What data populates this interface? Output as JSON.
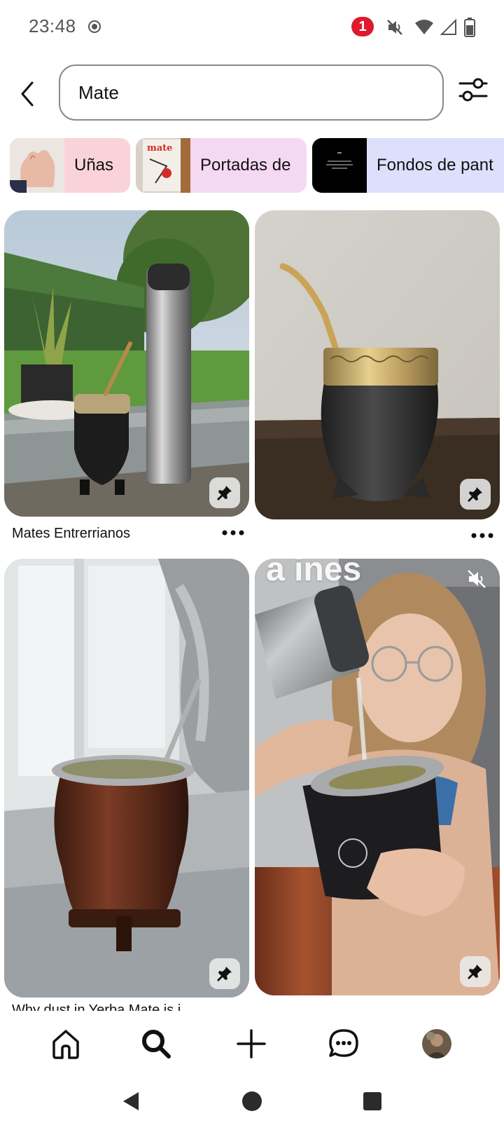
{
  "status_bar": {
    "time": "23:48",
    "notification_count": "1"
  },
  "search": {
    "query": "Mate"
  },
  "chips": [
    {
      "label": "Uñas",
      "bg": "#f9d3d8"
    },
    {
      "label": "Portadas de",
      "bg": "#f5d8f2"
    },
    {
      "label": "Fondos de pant",
      "bg": "#dde0fb"
    }
  ],
  "chip_thumb_texts": {
    "portadas_thumb": "mate"
  },
  "pins": [
    {
      "title": "Mates Entrerrianos",
      "overlay": ""
    },
    {
      "title": "",
      "overlay": ""
    },
    {
      "title": "",
      "overlay": ""
    },
    {
      "title": "",
      "overlay": "De un mate a ines"
    }
  ],
  "partial_caption": "Why dust in Yerba Mate is i...",
  "colors": {
    "notification_badge": "#e0182d",
    "accent": "#111111"
  },
  "icons": {
    "back": "chevron-left-icon",
    "filter": "sliders-icon",
    "home": "home-icon",
    "search": "search-icon",
    "create": "plus-icon",
    "messages": "chat-icon",
    "save": "pushpin-icon"
  }
}
